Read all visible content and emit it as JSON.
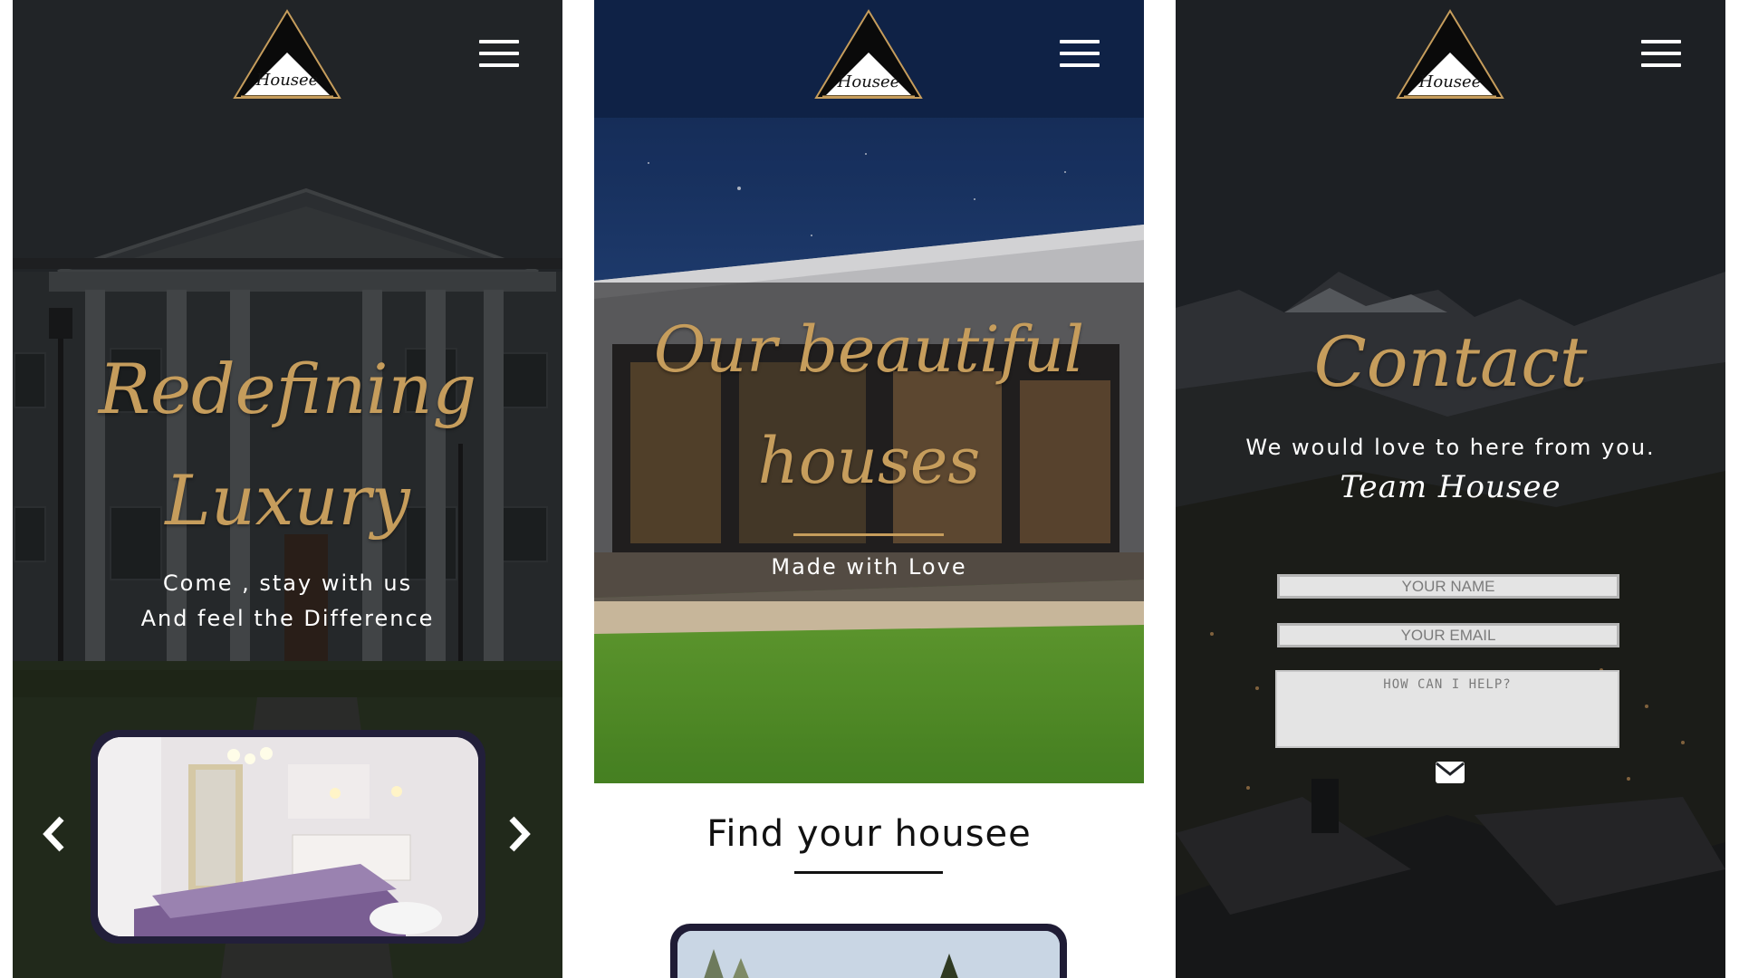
{
  "brand": {
    "logo_text": "Housee"
  },
  "screens": [
    {
      "hero_title_line1": "Redefining",
      "hero_title_line2": "Luxury",
      "tagline_line1": "Come  ,  stay  with  us",
      "tagline_line2": "And  feel  the  Difference"
    },
    {
      "hero_title_line1": "Our beautiful",
      "hero_title_line2": "houses",
      "subtitle": "Made  with  Love",
      "section_title": "Find  your  housee"
    },
    {
      "title": "Contact",
      "message": "We  would  love  to  here  from  you.",
      "signature": "Team Housee",
      "form": {
        "name_placeholder": "YOUR NAME",
        "email_placeholder": "YOUR EMAIL",
        "message_placeholder": "HOW CAN I HELP?"
      }
    }
  ],
  "colors": {
    "gold": "#c69d5c",
    "carousel_frame": "#221f3a",
    "white": "#ffffff",
    "night_sky": "#1c3566"
  },
  "icons": [
    "housee-logo-icon",
    "hamburger-menu-icon",
    "chevron-left-icon",
    "chevron-right-icon",
    "envelope-icon"
  ]
}
